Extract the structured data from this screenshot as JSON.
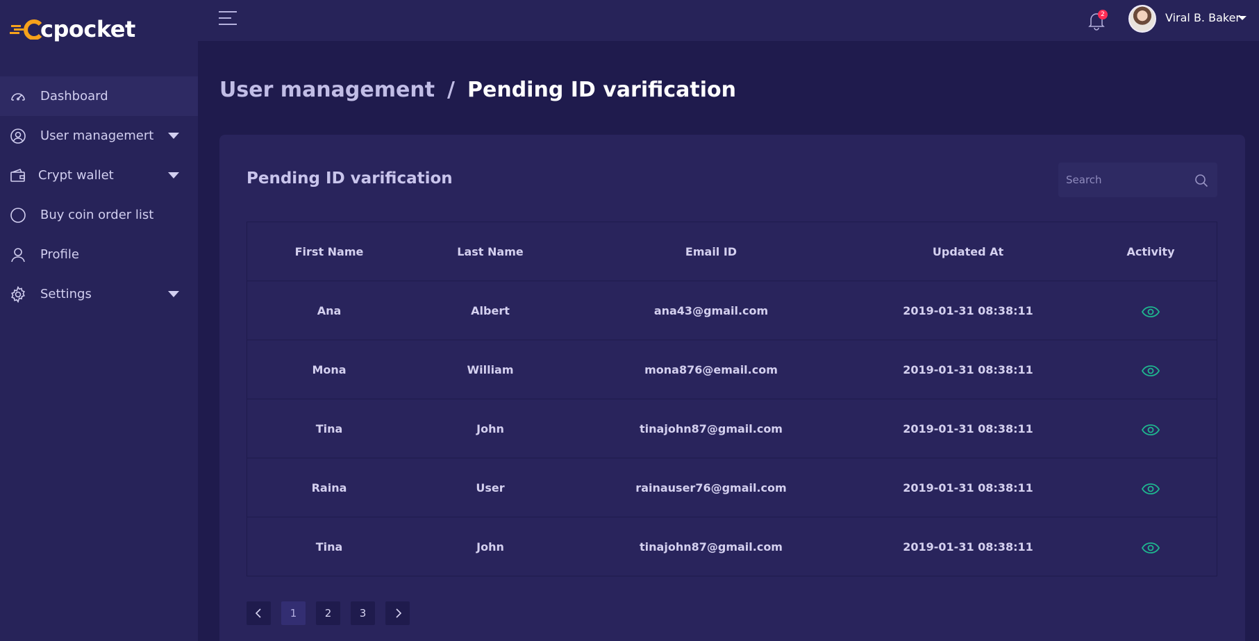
{
  "brand": {
    "logo_text": "cpocket",
    "accent": "#f7a21b"
  },
  "sidebar": {
    "items": [
      {
        "label": "Dashboard",
        "icon": "speedometer-icon",
        "active": true,
        "has_submenu": false
      },
      {
        "label": "User managemert",
        "icon": "user-circle-icon",
        "active": false,
        "has_submenu": true
      },
      {
        "label": "Crypt wallet",
        "icon": "wallet-icon",
        "active": false,
        "has_submenu": true
      },
      {
        "label": "Buy coin order list",
        "icon": "circle-icon",
        "active": false,
        "has_submenu": false
      },
      {
        "label": "Profile",
        "icon": "user-icon",
        "active": false,
        "has_submenu": false
      },
      {
        "label": "Settings",
        "icon": "gear-icon",
        "active": false,
        "has_submenu": true
      }
    ]
  },
  "header": {
    "notifications_count": "2",
    "user_name": "Viral B. Baker"
  },
  "breadcrumb": {
    "parent": "User management",
    "separator": "/",
    "current": "Pending ID varification"
  },
  "card": {
    "title": "Pending ID varification",
    "search_placeholder": "Search"
  },
  "table": {
    "columns": [
      "First Name",
      "Last Name",
      "Email ID",
      "Updated At",
      "Activity"
    ],
    "rows": [
      {
        "first": "Ana",
        "last": "Albert",
        "email": "ana43@gmail.com",
        "updated": "2019-01-31 08:38:11",
        "activity": "view-icon"
      },
      {
        "first": "Mona",
        "last": "William",
        "email": "mona876@email.com",
        "updated": "2019-01-31 08:38:11",
        "activity": "view-icon"
      },
      {
        "first": "Tina",
        "last": "John",
        "email": "tinajohn87@gmail.com",
        "updated": "2019-01-31 08:38:11",
        "activity": "view-icon"
      },
      {
        "first": "Raina",
        "last": "User",
        "email": "rainauser76@gmail.com",
        "updated": "2019-01-31 08:38:11",
        "activity": "view-icon"
      },
      {
        "first": "Tina",
        "last": "John",
        "email": "tinajohn87@gmail.com",
        "updated": "2019-01-31 08:38:11",
        "activity": "view-icon"
      }
    ]
  },
  "pagination": {
    "pages": [
      "1",
      "2",
      "3"
    ],
    "current": "1",
    "prev_icon": "chevron-left-icon",
    "next_icon": "chevron-right-icon"
  },
  "colors": {
    "background": "#1f1b4d",
    "sidebar": "#272359",
    "card": "#29245c",
    "eye_icon": "#1fb58f",
    "badge": "#ff2d55"
  }
}
